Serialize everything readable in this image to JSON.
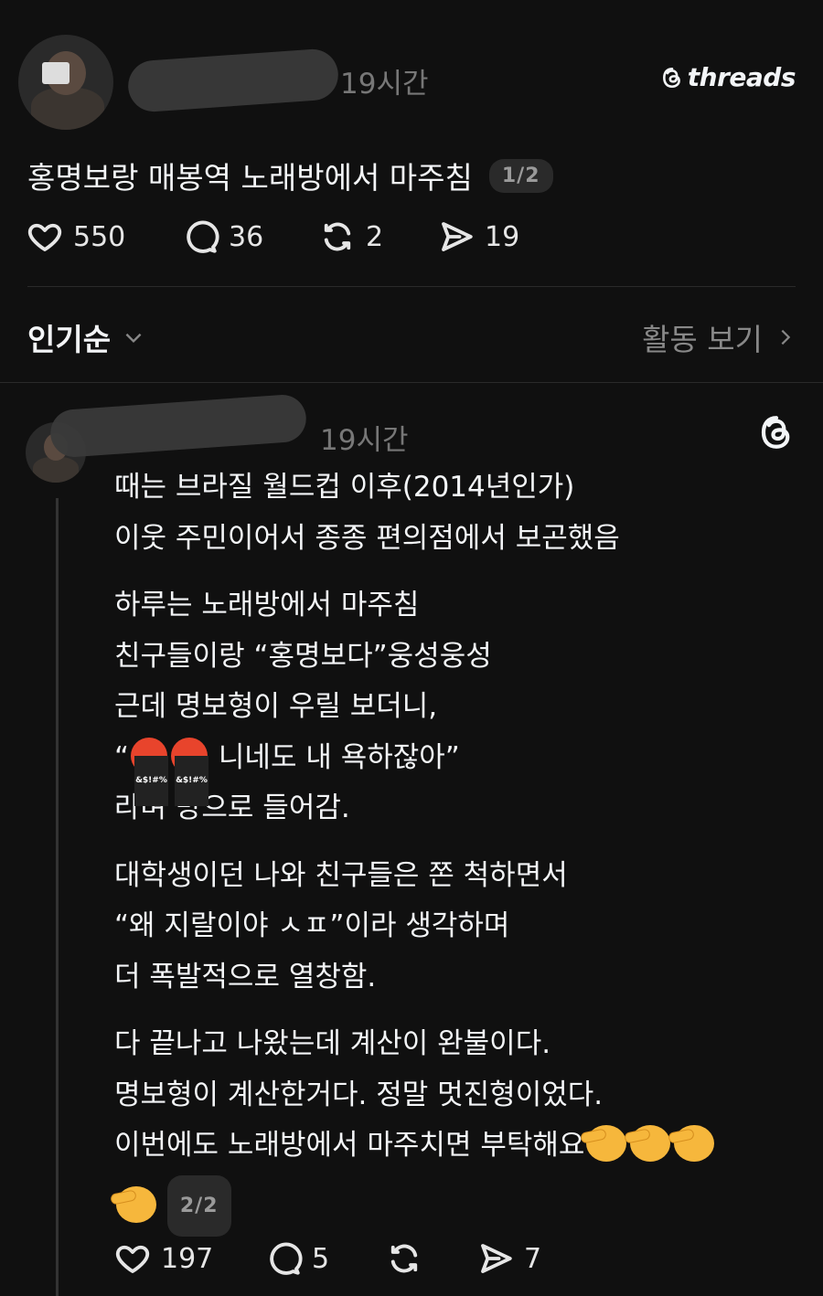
{
  "brand": {
    "name": "threads"
  },
  "post": {
    "time": "19시간",
    "title": "홍명보랑 매봉역 노래방에서 마주침",
    "pager": "1/2",
    "likes": "550",
    "comments": "36",
    "reposts": "2",
    "shares": "19"
  },
  "sort": {
    "label": "인기순",
    "activity_label": "활동 보기"
  },
  "reply": {
    "time": "19시간",
    "paragraphs": [
      [
        "때는 브라질 월드컵 이후(2014년인가)",
        "이웃 주민이어서 종종 편의점에서 보곤했음"
      ],
      [
        "하루는 노래방에서 마주침",
        "친구들이랑 “홍명보다”웅성웅성",
        "근데 명보형이 우릴 보더니,"
      ],
      [
        "대학생이던 나와 친구들은 쫀 척하면서",
        "“왜 지랄이야 ㅅㅍ”이라 생각하며",
        "더 폭발적으로 열창함."
      ],
      [
        "다 끝나고 나왔는데 계산이 완불이다.",
        "명보형이 계산한거다. 정말 멋진형이었다.",
        "이번에도 노래방에서 마주치면 부탁해요"
      ]
    ],
    "quote_text": " 니네도 내 욕하잖아”",
    "quote_open": "“",
    "after_quote": "라며 방으로 들어감.",
    "pager": "2/2",
    "likes": "197",
    "comments": "5",
    "shares": "7"
  },
  "icons": [
    "heart-icon",
    "comment-icon",
    "repost-icon",
    "share-icon",
    "chevron-down-icon",
    "chevron-right-icon",
    "threads-logo-icon"
  ]
}
